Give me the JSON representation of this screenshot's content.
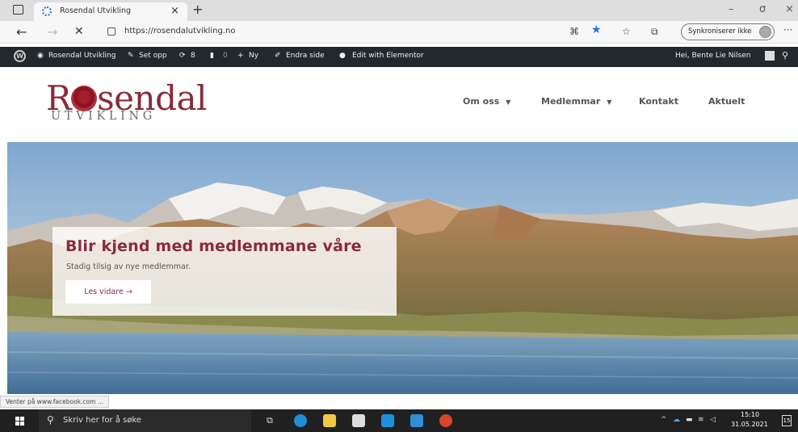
{
  "browser": {
    "tab_title": "Rosendal Utvikling",
    "tab_close": "×",
    "new_tab": "+",
    "url": "https://rosendalutvikling.no",
    "sync_label": "Synkroniserer ikke",
    "more": "···",
    "minimize": "–",
    "maximize": "σ",
    "close": "×",
    "back": "←",
    "forward": "→",
    "stop": "✕",
    "accent": "#1a73e8"
  },
  "adminbar": {
    "site_name": "Rosendal Utvikling",
    "setup": "Set opp",
    "updates": "8",
    "comments": "0",
    "new": "Ny",
    "edit_page": "Endra side",
    "elementor": "Edit with Elementor",
    "greeting": "Hei, Bente Lie Nilsen",
    "bg_color": "#23282d"
  },
  "site": {
    "logo_pre": "R",
    "logo_post": "sendal",
    "logo_sub": "UTVIKLING",
    "brand_color": "#8a2a3a",
    "menu": [
      {
        "label": "Om oss",
        "has_dropdown": true
      },
      {
        "label": "Medlemmar",
        "has_dropdown": true
      },
      {
        "label": "Kontakt",
        "has_dropdown": false
      },
      {
        "label": "Aktuelt",
        "has_dropdown": false
      }
    ],
    "hero": {
      "title": "Blir kjend med medlemmane våre",
      "subtitle": "Stadig tilsig av nye medlemmar.",
      "button": "Les vidare →"
    }
  },
  "status": {
    "text": "Venter på www.facebook.com ..."
  },
  "taskbar": {
    "search_placeholder": "Skriv her for å søke",
    "time": "15:10",
    "date": "31.05.2021",
    "notification_count": "15"
  }
}
